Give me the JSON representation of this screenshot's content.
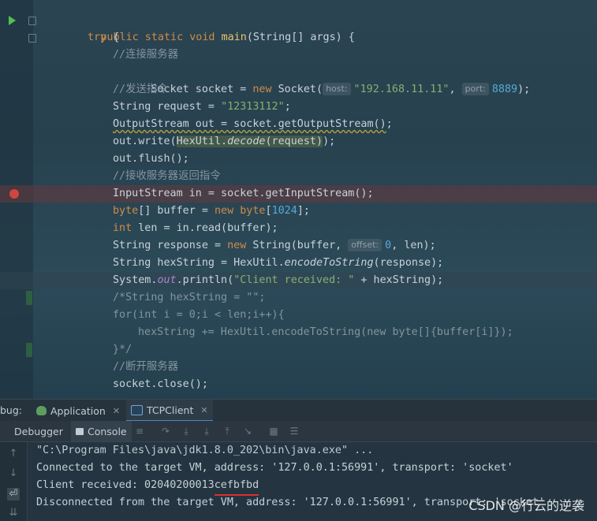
{
  "editor": {
    "lines": {
      "l1": {
        "kw1": "public static void ",
        "fn": "main",
        "rest": "(String[] args) {"
      },
      "l2": {
        "kw": "try",
        "rest": " {"
      },
      "l3": {
        "comment": "//连接服务器"
      },
      "l4": {
        "a": "Socket socket = ",
        "kw": "new",
        "b": " Socket(",
        "hint1": "host:",
        "str": "\"192.168.11.11\"",
        "c": ", ",
        "hint2": "port:",
        "num": "8889",
        "d": ");"
      },
      "l5": {
        "comment": "//发送指令"
      },
      "l6": {
        "a": "String request = ",
        "str": "\"12313112\"",
        "b": ";"
      },
      "l7": {
        "a": "OutputStream out = socket.getOutputStream()",
        "b": ";"
      },
      "l8": {
        "a": "out.write(",
        "hl_a": "HexUtil.",
        "hl_b": "decode",
        "hl_c": "(request)",
        "b": ");"
      },
      "l9": {
        "a": "out.flush();"
      },
      "l10": {
        "comment": "//接收服务器返回指令"
      },
      "l11": {
        "a": "InputStream in = socket.getInputStream();"
      },
      "l12": {
        "kw": "byte",
        "a": "[] buffer = ",
        "kw2": "new byte",
        "b": "[",
        "num": "1024",
        "c": "];"
      },
      "l13": {
        "kw": "int",
        "a": " len = in.read(buffer);"
      },
      "l14": {
        "a": "String response = ",
        "kw": "new",
        "b": " String(buffer, ",
        "hint": "offset:",
        "num": "0",
        "c": ", len);"
      },
      "l15": {
        "a": "String hexString = HexUtil.",
        "it": "encodeToString",
        "b": "(response);"
      },
      "l16": {
        "a": "System.",
        "fld": "out",
        "b": ".println(",
        "str": "\"Client received: \"",
        "c": " + hexString);"
      },
      "l17": {
        "comment": "/*String hexString = \"\";"
      },
      "l18": {
        "comment": "for(int i = 0;i < len;i++){"
      },
      "l19": {
        "comment": "hexString += HexUtil.encodeToString(new byte[]{buffer[i]});"
      },
      "l20": {
        "comment": "}*/"
      },
      "l21": {
        "comment": "//断开服务器"
      },
      "l22": {
        "a": "socket.close();"
      }
    }
  },
  "debug": {
    "label": "bug:",
    "tabs": [
      {
        "label": "Application"
      },
      {
        "label": "TCPClient"
      }
    ],
    "sub_tabs": [
      {
        "label": "Debugger"
      },
      {
        "label": "Console"
      }
    ]
  },
  "console": {
    "lines": [
      "\"C:\\Program Files\\java\\jdk1.8.0_202\\bin\\java.exe\" ...",
      "Connected to the target VM, address: '127.0.0.1:56991', transport: 'socket'",
      "Client received: 02040200013cefbfbd",
      "Disconnected from the target VM, address: '127.0.0.1:56991', transport: 'socket'"
    ]
  },
  "watermark": "CSDN @行云的逆袭",
  "colors": {
    "keyword": "#d08b46",
    "function": "#e8c46a",
    "comment": "#84949e",
    "string": "#87b071",
    "number": "#57a9d6",
    "breakpoint": "#d0463e",
    "run": "#52c14b",
    "underline": "#d8312b"
  }
}
